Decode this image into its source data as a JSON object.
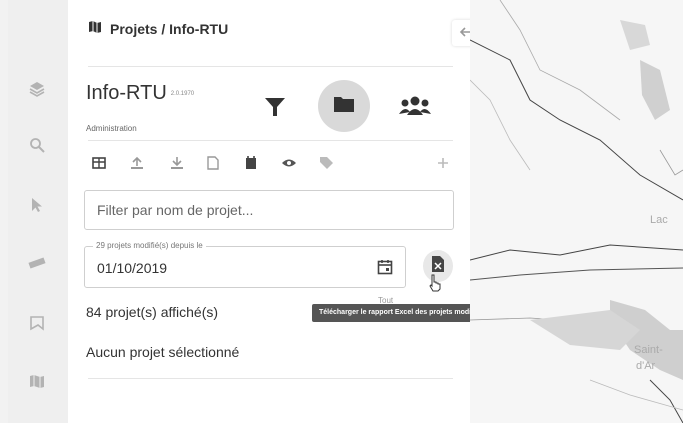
{
  "breadcrumb": {
    "text": "Projets / Info-RTU"
  },
  "app": {
    "title": "Info-RTU",
    "version": "2.0.1970",
    "subtitle": "Administration"
  },
  "search": {
    "placeholder": "Filter par nom de projet..."
  },
  "date_filter": {
    "legend": "29 projets modifié(s) depuis le",
    "value": "01/10/2019"
  },
  "status": {
    "count": "84 projet(s) affiché(s)",
    "selection": "Aucun projet sélectionné",
    "tout": "Tout"
  },
  "tooltip": {
    "text": "Télécharger le rapport Excel des projets modifiés"
  },
  "map": {
    "label_1": "Lac",
    "label_2": "Saint-",
    "label_3": "d'Ar"
  },
  "colors": {
    "panel_bg": "#ffffff",
    "rail_bg": "#efefef",
    "tooltip_bg": "#555555",
    "icon_dark": "#333333"
  },
  "icons": {
    "rail": [
      "layers-icon",
      "search-icon",
      "cursor-icon",
      "ruler-icon",
      "flag-icon",
      "map-icon"
    ],
    "toolbar": [
      "table-icon",
      "upload-icon",
      "download-icon",
      "document-icon",
      "calendar-icon",
      "eye-icon",
      "tags-icon",
      "plus-icon"
    ]
  }
}
